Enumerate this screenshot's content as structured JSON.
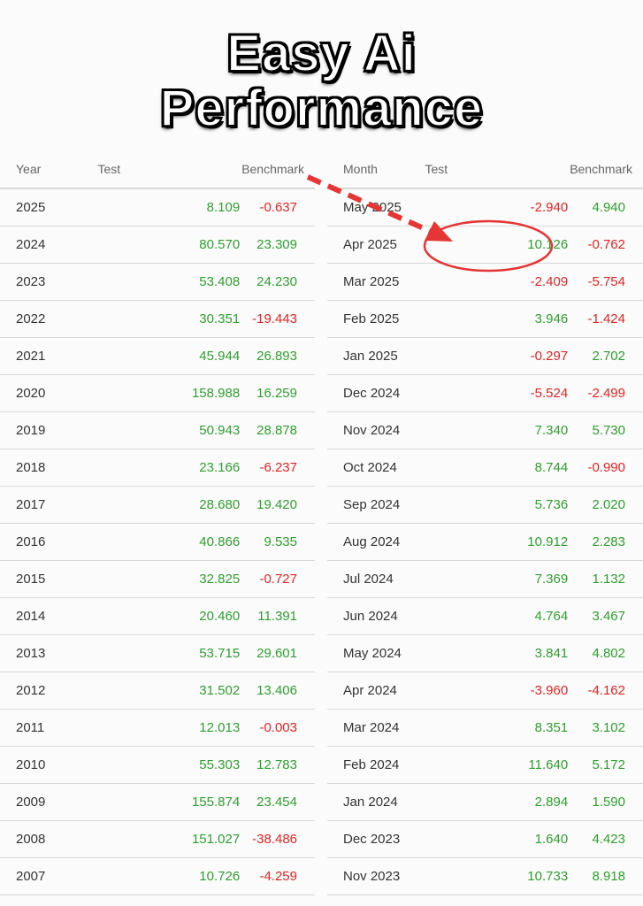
{
  "title": {
    "line1": "Easy Ai",
    "line2": "Performance"
  },
  "colors": {
    "positive": "#2e9e2e",
    "negative": "#e02424",
    "annotation": "#e53535"
  },
  "yearly": {
    "headers": [
      "Year",
      "Test",
      "Benchmark"
    ],
    "rows": [
      [
        "2025",
        "8.109",
        "-0.637"
      ],
      [
        "2024",
        "80.570",
        "23.309"
      ],
      [
        "2023",
        "53.408",
        "24.230"
      ],
      [
        "2022",
        "30.351",
        "-19.443"
      ],
      [
        "2021",
        "45.944",
        "26.893"
      ],
      [
        "2020",
        "158.988",
        "16.259"
      ],
      [
        "2019",
        "50.943",
        "28.878"
      ],
      [
        "2018",
        "23.166",
        "-6.237"
      ],
      [
        "2017",
        "28.680",
        "19.420"
      ],
      [
        "2016",
        "40.866",
        "9.535"
      ],
      [
        "2015",
        "32.825",
        "-0.727"
      ],
      [
        "2014",
        "20.460",
        "11.391"
      ],
      [
        "2013",
        "53.715",
        "29.601"
      ],
      [
        "2012",
        "31.502",
        "13.406"
      ],
      [
        "2011",
        "12.013",
        "-0.003"
      ],
      [
        "2010",
        "55.303",
        "12.783"
      ],
      [
        "2009",
        "155.874",
        "23.454"
      ],
      [
        "2008",
        "151.027",
        "-38.486"
      ],
      [
        "2007",
        "10.726",
        "-4.259"
      ]
    ]
  },
  "monthly": {
    "headers": [
      "Month",
      "Test",
      "Benchmark"
    ],
    "rows": [
      [
        "May 2025",
        "-2.940",
        "4.940"
      ],
      [
        "Apr 2025",
        "10.126",
        "-0.762"
      ],
      [
        "Mar 2025",
        "-2.409",
        "-5.754"
      ],
      [
        "Feb 2025",
        "3.946",
        "-1.424"
      ],
      [
        "Jan 2025",
        "-0.297",
        "2.702"
      ],
      [
        "Dec 2024",
        "-5.524",
        "-2.499"
      ],
      [
        "Nov 2024",
        "7.340",
        "5.730"
      ],
      [
        "Oct 2024",
        "8.744",
        "-0.990"
      ],
      [
        "Sep 2024",
        "5.736",
        "2.020"
      ],
      [
        "Aug 2024",
        "10.912",
        "2.283"
      ],
      [
        "Jul 2024",
        "7.369",
        "1.132"
      ],
      [
        "Jun 2024",
        "4.764",
        "3.467"
      ],
      [
        "May 2024",
        "3.841",
        "4.802"
      ],
      [
        "Apr 2024",
        "-3.960",
        "-4.162"
      ],
      [
        "Mar 2024",
        "8.351",
        "3.102"
      ],
      [
        "Feb 2024",
        "11.640",
        "5.172"
      ],
      [
        "Jan 2024",
        "2.894",
        "1.590"
      ],
      [
        "Dec 2023",
        "1.640",
        "4.423"
      ],
      [
        "Nov 2023",
        "10.733",
        "8.918"
      ]
    ]
  },
  "annotation": {
    "highlight_icon": "red-circle-highlight",
    "arrow_icon": "dashed-arrow-icon"
  }
}
